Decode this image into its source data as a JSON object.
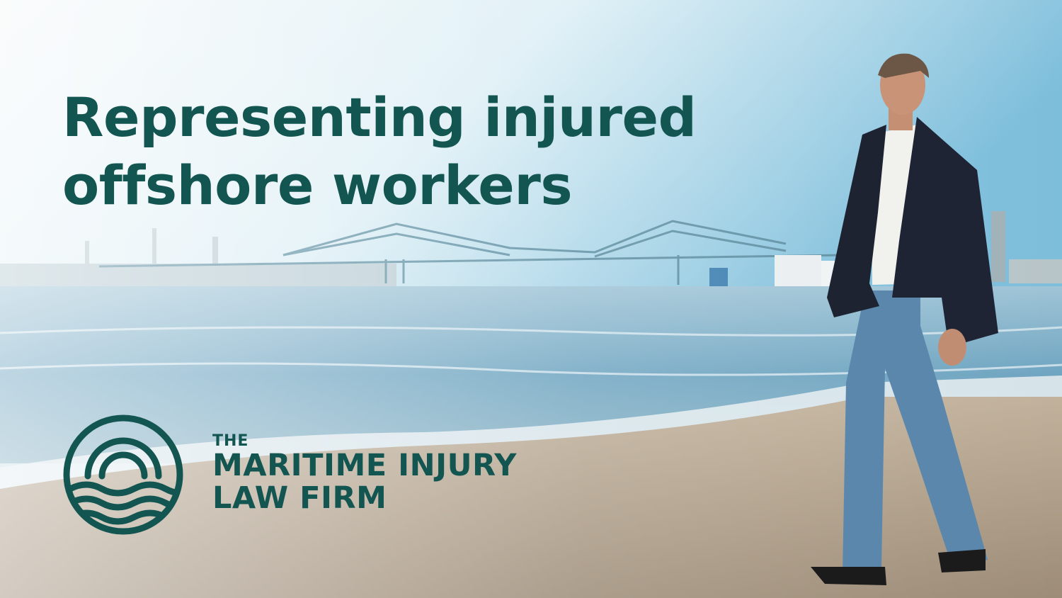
{
  "headline": {
    "line1": "Representing injured",
    "line2": "offshore workers"
  },
  "brand": {
    "the": "THE",
    "line1": "MARITIME INJURY",
    "line2": "LAW FIRM"
  },
  "colors": {
    "brand_green": "#135551",
    "sky": "#cfe6ef",
    "water": "#6fa6c2",
    "sand": "#b7a58f"
  },
  "icons": {
    "logo": "sun-over-waves-icon"
  }
}
